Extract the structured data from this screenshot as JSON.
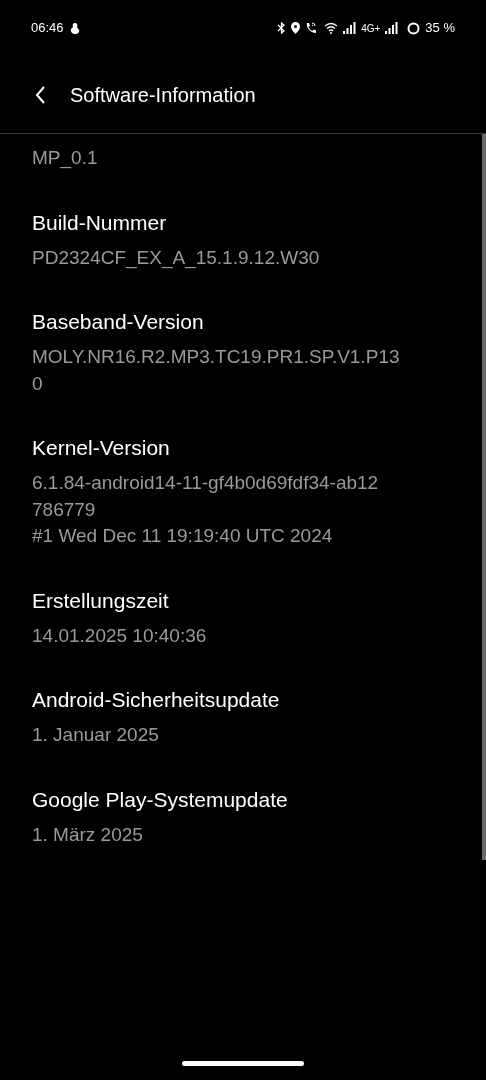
{
  "status_bar": {
    "time": "06:46",
    "network_label": "4G+",
    "battery": "35 %"
  },
  "header": {
    "title": "Software-Information"
  },
  "items": [
    {
      "value_lines": [
        "MP_0.1"
      ]
    },
    {
      "title": "Build-Nummer",
      "value_lines": [
        "PD2324CF_EX_A_15.1.9.12.W30"
      ]
    },
    {
      "title": "Baseband-Version",
      "value_lines": [
        "MOLY.NR16.R2.MP3.TC19.PR1.SP.V1.P13",
        "0"
      ]
    },
    {
      "title": "Kernel-Version",
      "value_lines": [
        "6.1.84-android14-11-gf4b0d69fdf34-ab12",
        "786779",
        "#1 Wed Dec 11 19:19:40 UTC 2024"
      ]
    },
    {
      "title": "Erstellungszeit",
      "value_lines": [
        "14.01.2025 10:40:36"
      ]
    },
    {
      "title": "Android-Sicherheitsupdate",
      "value_lines": [
        "1. Januar 2025"
      ]
    },
    {
      "title": "Google Play-Systemupdate",
      "value_lines": [
        "1. März 2025"
      ]
    }
  ]
}
